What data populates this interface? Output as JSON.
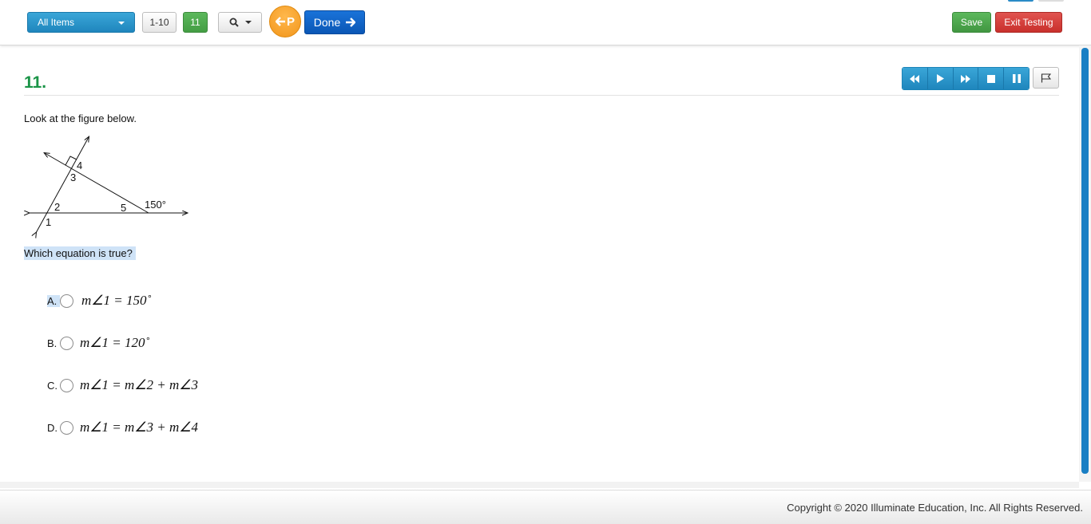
{
  "toolbar": {
    "items_dropdown_label": "All Items",
    "range_label": "1-10",
    "current_item_label": "11",
    "pointer_label": "P",
    "done_label": "Done",
    "save_label": "Save",
    "exit_label": "Exit Testing",
    "search_icon": "search-icon"
  },
  "question": {
    "number": "11.",
    "stem": "Look at the figure below.",
    "figure_labels": [
      "4",
      "3",
      "2",
      "5",
      "1",
      "150°"
    ],
    "prompt": "Which equation is true?",
    "choices": [
      {
        "letter": "A.",
        "math": "m∠1 = 150˚",
        "selected": false
      },
      {
        "letter": "B.",
        "math": "m∠1 = 120˚",
        "selected": false
      },
      {
        "letter": "C.",
        "math": "m∠1 = m∠2 + m∠3",
        "selected": false
      },
      {
        "letter": "D.",
        "math": "m∠1 = m∠3 + m∠4",
        "selected": false
      }
    ]
  },
  "player": {
    "buttons": [
      "rewind-icon",
      "play-icon",
      "fast-forward-icon",
      "stop-icon",
      "pause-icon"
    ],
    "flag_icon": "flag-icon"
  },
  "footer": {
    "copyright": "Copyright © 2020 Illuminate Education, Inc. All Rights Reserved."
  },
  "colors": {
    "accent_blue": "#1f86bd",
    "green": "#5cb85c",
    "red": "#c9302c",
    "orange": "#f2961b",
    "question_number": "#1a9447"
  }
}
